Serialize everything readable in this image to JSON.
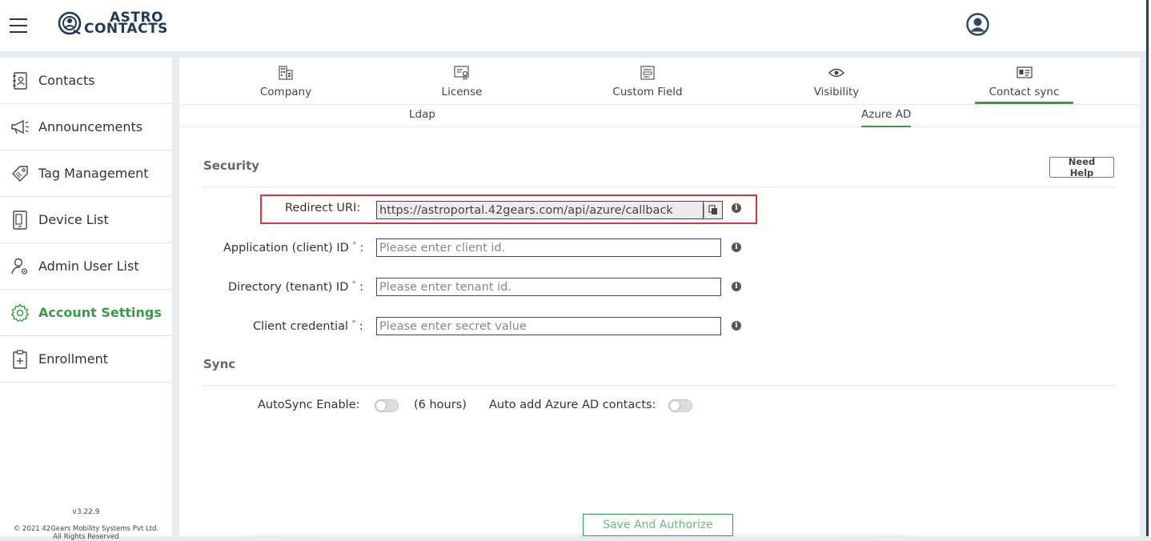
{
  "header": {
    "logo_line1": "ASTRO",
    "logo_line2": "CONTACTS"
  },
  "sidebar": {
    "items": [
      {
        "label": "Contacts",
        "icon": "contacts-book-icon"
      },
      {
        "label": "Announcements",
        "icon": "megaphone-icon"
      },
      {
        "label": "Tag Management",
        "icon": "tag-icon"
      },
      {
        "label": "Device List",
        "icon": "devices-icon"
      },
      {
        "label": "Admin User List",
        "icon": "admin-user-icon"
      },
      {
        "label": "Account Settings",
        "icon": "gear-icon",
        "active": true
      },
      {
        "label": "Enrollment",
        "icon": "clipboard-icon"
      }
    ],
    "version": "v3.22.9",
    "copyright": "© 2021 42Gears Mobility Systems Pvt Ltd.",
    "copyright2": "All Rights Reserved"
  },
  "tabs": [
    {
      "label": "Company",
      "icon": "company-icon"
    },
    {
      "label": "License",
      "icon": "license-icon"
    },
    {
      "label": "Custom Field",
      "icon": "custom-field-icon"
    },
    {
      "label": "Visibility",
      "icon": "eye-icon"
    },
    {
      "label": "Contact sync",
      "icon": "contact-card-icon",
      "active": true
    }
  ],
  "subtabs": [
    {
      "label": "Ldap"
    },
    {
      "label": "Azure AD",
      "active": true
    }
  ],
  "security": {
    "title": "Security",
    "help_button": "Need Help",
    "redirect_label": "Redirect URI:",
    "redirect_value": "https://astroportal.42gears.com/api/azure/callback",
    "client_id_label": "Application (client) ID",
    "client_id_placeholder": "Please enter client id.",
    "tenant_id_label": "Directory (tenant) ID",
    "tenant_id_placeholder": "Please enter tenant id.",
    "credential_label": "Client credential",
    "credential_placeholder": "Please enter secret value",
    "required_mark": "*",
    "colon": ":",
    "info_glyph": "i"
  },
  "sync": {
    "title": "Sync",
    "autosync_label": "AutoSync Enable:",
    "autosync_interval": "(6 hours)",
    "autosync_enabled": false,
    "auto_add_label": "Auto add Azure AD contacts:",
    "auto_add_enabled": false
  },
  "save_button": "Save And Authorize",
  "colors": {
    "accent_green": "#3a9a47",
    "highlight_red": "#d9363e",
    "brand_navy": "#1f3a58"
  }
}
